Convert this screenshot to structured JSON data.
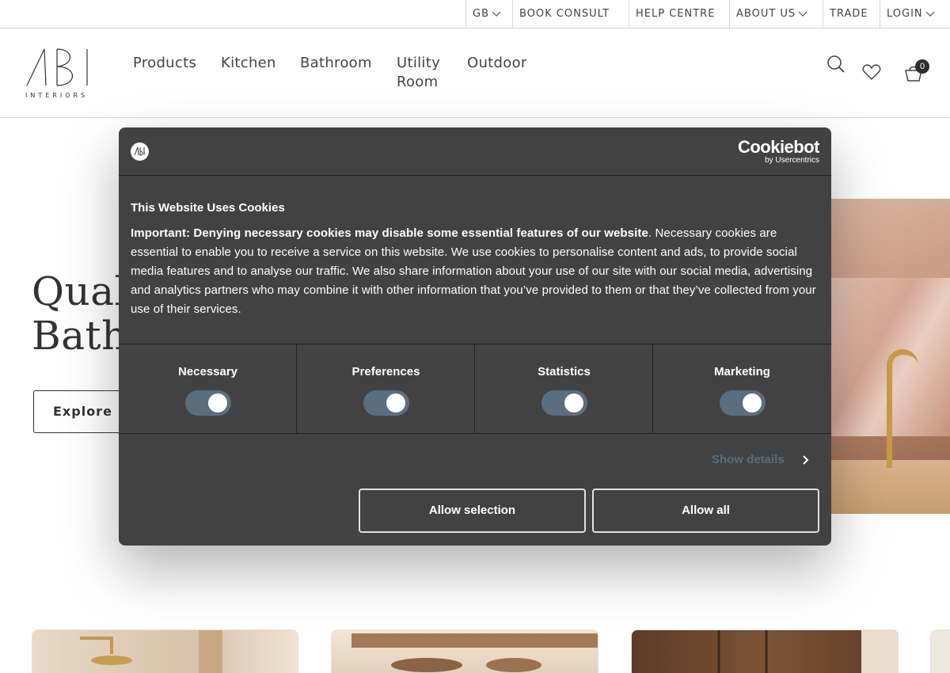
{
  "topbar": {
    "country": "GB",
    "book_consult": "BOOK CONSULT",
    "help_centre": "HELP CENTRE",
    "about_us": "ABOUT US",
    "trade": "TRADE",
    "login": "LOGIN"
  },
  "header": {
    "logo_text": "INTERIORS",
    "nav": [
      "Products",
      "Kitchen",
      "Bathroom",
      "Utility Room",
      "Outdoor"
    ],
    "cart_count": "0"
  },
  "hero": {
    "title_line1": "Quali",
    "title_line2": "Bathr",
    "explore_label": "Explore"
  },
  "cookie": {
    "brand": "Cookiebot",
    "brand_sub": "by Usercentrics",
    "title": "This Website Uses Cookies",
    "body_bold": "Important: Denying necessary cookies may disable some essential features of our website",
    "body_rest": ". Necessary cookies are essential to enable you to receive a service on this website. We use cookies to personalise content and ads, to provide social media features and to analyse our traffic. We also share information about your use of our site with our social media, advertising and analytics partners who may combine it with other information that you’ve provided to them or that they’ve collected from your use of their services.",
    "categories": [
      {
        "label": "Necessary",
        "enabled": true
      },
      {
        "label": "Preferences",
        "enabled": true
      },
      {
        "label": "Statistics",
        "enabled": true
      },
      {
        "label": "Marketing",
        "enabled": true
      }
    ],
    "show_details": "Show details",
    "allow_selection": "Allow selection",
    "allow_all": "Allow all"
  },
  "colors": {
    "dialog_bg": "#424242",
    "toggle_on": "#5a6e80",
    "text_dark": "#2f2f2f"
  }
}
